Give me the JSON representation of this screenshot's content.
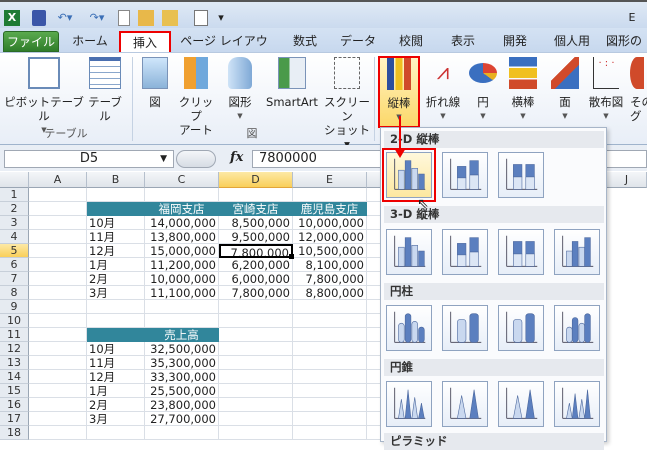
{
  "window": {
    "title_partial": "E"
  },
  "quick_access": [
    "excel-icon",
    "save-icon",
    "undo-icon",
    "redo-icon",
    "new-icon",
    "open-icon",
    "folder-icon",
    "print-preview-icon",
    "customize-icon"
  ],
  "tabs": [
    "ファイル",
    "ホーム",
    "挿入",
    "ページ レイアウト",
    "数式",
    "データ",
    "校閲",
    "表示",
    "開発",
    "個人用",
    "図形の"
  ],
  "active_tab": "挿入",
  "ribbon": {
    "buttons": [
      {
        "label": "ピボットテーブル",
        "icon": "pivot-table-icon"
      },
      {
        "label": "テーブル",
        "icon": "table-icon"
      },
      {
        "label": "図",
        "icon": "picture-icon"
      },
      {
        "label": "クリップ",
        "label2": "アート",
        "icon": "clip-art-icon"
      },
      {
        "label": "図形",
        "icon": "shapes-icon"
      },
      {
        "label": "SmartArt",
        "icon": "smartart-icon"
      },
      {
        "label": "スクリーン",
        "label2": "ショット",
        "icon": "screenshot-icon"
      },
      {
        "label": "縦棒",
        "icon": "column-chart-icon"
      },
      {
        "label": "折れ線",
        "icon": "line-chart-icon"
      },
      {
        "label": "円",
        "icon": "pie-chart-icon"
      },
      {
        "label": "横棒",
        "icon": "bar-chart-icon"
      },
      {
        "label": "面",
        "icon": "area-chart-icon"
      },
      {
        "label": "散布図",
        "icon": "scatter-chart-icon"
      },
      {
        "label": "その",
        "label2": "グ",
        "icon": "other-chart-icon"
      }
    ],
    "groups": [
      "テーブル",
      "図"
    ]
  },
  "formula_bar": {
    "name_box": "D5",
    "fx": "fx",
    "value": "7800000"
  },
  "columns": [
    "A",
    "B",
    "C",
    "D",
    "E",
    "J"
  ],
  "rows": [
    "1",
    "2",
    "3",
    "4",
    "5",
    "6",
    "7",
    "8",
    "9",
    "10",
    "11",
    "12",
    "13",
    "14",
    "15",
    "16",
    "17",
    "18"
  ],
  "table1": {
    "headers": [
      "福岡支店",
      "宮崎支店",
      "鹿児島支店"
    ],
    "rows": [
      [
        "10月",
        "14,000,000",
        "8,500,000",
        "10,000,000"
      ],
      [
        "11月",
        "13,800,000",
        "9,500,000",
        "12,000,000"
      ],
      [
        "12月",
        "15,000,000",
        "7,800,000",
        "10,500,000"
      ],
      [
        "1月",
        "11,200,000",
        "6,200,000",
        "8,100,000"
      ],
      [
        "2月",
        "10,000,000",
        "6,000,000",
        "7,800,000"
      ],
      [
        "3月",
        "11,100,000",
        "7,800,000",
        "8,800,000"
      ]
    ]
  },
  "table2": {
    "header": "売上高",
    "rows": [
      [
        "10月",
        "32,500,000"
      ],
      [
        "11月",
        "35,300,000"
      ],
      [
        "12月",
        "33,300,000"
      ],
      [
        "1月",
        "25,500,000"
      ],
      [
        "2月",
        "23,800,000"
      ],
      [
        "3月",
        "27,700,000"
      ]
    ]
  },
  "chart_menu": {
    "sections": [
      {
        "title": "2-D 縦棒",
        "items": [
          "集合縦棒",
          "積み上げ縦棒",
          "100% 積み上げ縦棒"
        ]
      },
      {
        "title": "3-D 縦棒",
        "items": [
          "3-D 集合縦棒",
          "3-D 積み上げ縦棒",
          "3-D 100% 積み上げ縦棒",
          "3-D 縦棒"
        ]
      },
      {
        "title": "円柱",
        "items": [
          "集合円柱",
          "積み上げ円柱",
          "100% 積み上げ円柱",
          "3-D 円柱"
        ]
      },
      {
        "title": "円錐",
        "items": [
          "集合円錐",
          "積み上げ円錐",
          "100% 積み上げ円錐",
          "3-D 円錐"
        ]
      },
      {
        "title": "ピラミッド",
        "items": []
      }
    ]
  },
  "colors": {
    "header_fill": "#31869b",
    "highlight": "#ee0000"
  }
}
